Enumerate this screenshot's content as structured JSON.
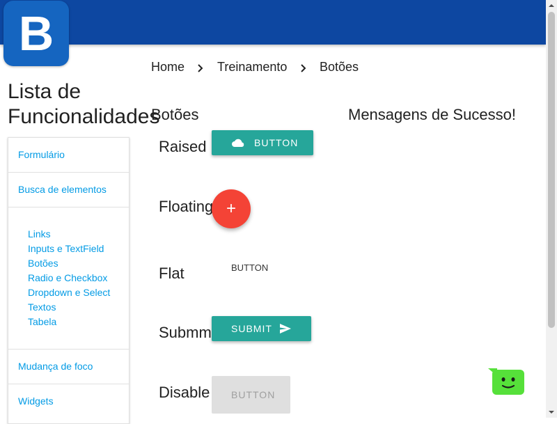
{
  "logo": {
    "letter": "B"
  },
  "breadcrumb": {
    "items": [
      "Home",
      "Treinamento",
      "Botões"
    ]
  },
  "sidebar": {
    "title_line1": "Lista de",
    "title_line2": "Funcionalidades",
    "items": [
      "Formulário",
      "Busca de elementos",
      "Mudança de foco",
      "Widgets"
    ],
    "subitems": [
      "Links",
      "Inputs e TextField",
      "Botões",
      "Radio e Checkbox",
      "Dropdown e Select",
      "Textos",
      "Tabela"
    ]
  },
  "main": {
    "section_title": "Botões",
    "success_title": "Mensagens de Sucesso!",
    "rows": {
      "raised": {
        "label": "Raised",
        "button": "BUTTON",
        "icon": "cloud-icon"
      },
      "floating": {
        "label": "Floating",
        "button": "+",
        "icon": "plus-icon"
      },
      "flat": {
        "label": "Flat",
        "button": "BUTTON"
      },
      "submit": {
        "label": "Submm",
        "button": "SUBMIT",
        "icon": "send-icon"
      },
      "disabled": {
        "label": "Disable",
        "button": "BUTTON"
      }
    }
  },
  "colors": {
    "topbar": "#0d47a1",
    "teal": "#26a69a",
    "fab": "#f44336",
    "link": "#039be5",
    "chat": "#56e03a"
  }
}
